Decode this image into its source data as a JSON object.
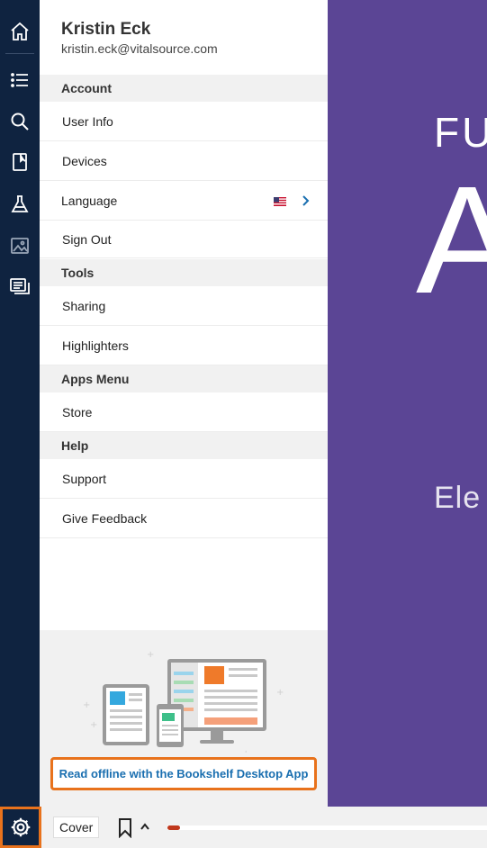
{
  "rail": {
    "items": [
      {
        "name": "home-icon"
      },
      {
        "name": "contents-list-icon"
      },
      {
        "name": "search-icon"
      },
      {
        "name": "bookmark-page-icon"
      },
      {
        "name": "lab-flask-icon"
      },
      {
        "name": "image-gallery-icon"
      },
      {
        "name": "flashcards-icon"
      }
    ]
  },
  "user": {
    "name": "Kristin Eck",
    "email": "kristin.eck@vitalsource.com"
  },
  "sections": {
    "account": "Account",
    "tools": "Tools",
    "apps_menu": "Apps Menu",
    "help": "Help"
  },
  "items": {
    "user_info": "User Info",
    "devices": "Devices",
    "language": "Language",
    "sign_out": "Sign Out",
    "sharing": "Sharing",
    "highlighters": "Highlighters",
    "store": "Store",
    "support": "Support",
    "give_feedback": "Give Feedback"
  },
  "promo": {
    "link": "Read offline with the Bookshelf Desktop App"
  },
  "book_cover": {
    "line1": "FU",
    "line2": "A",
    "line3": "Ele"
  },
  "bottom_bar": {
    "location_label": "Cover",
    "progress_fraction": 0.04
  },
  "colors": {
    "rail_bg": "#0f2340",
    "cover_bg": "#5b4595",
    "highlight_border": "#e8721c",
    "link": "#1a6fb0",
    "progress": "#c0381c"
  }
}
